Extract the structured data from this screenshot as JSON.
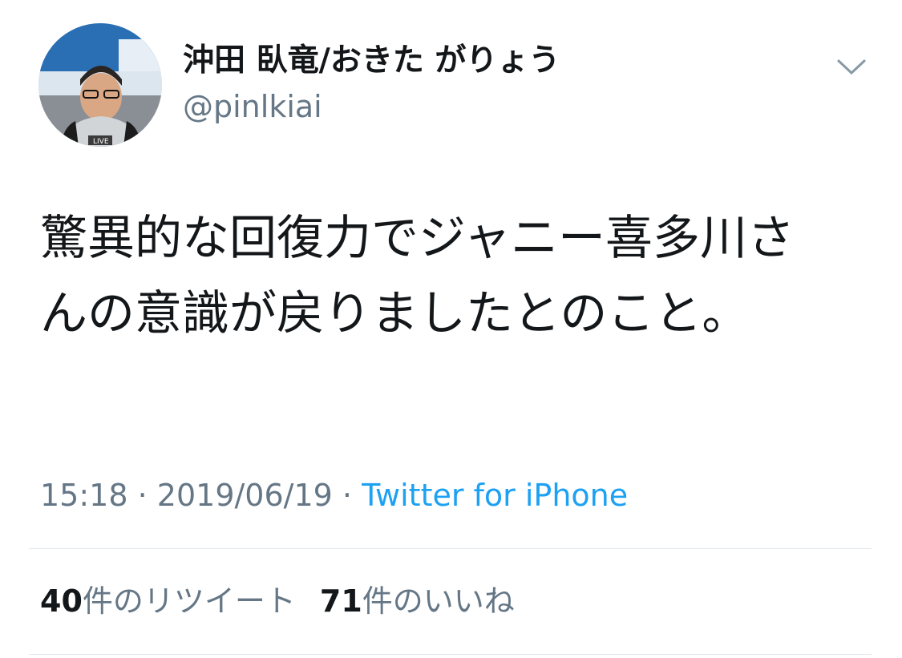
{
  "author": {
    "display_name": "沖田 臥竜/おきた がりょう",
    "handle": "@pinlkiai",
    "avatar_badge": "LIVE"
  },
  "tweet": {
    "text": "驚異的な回復力でジャニー喜多川さんの意識が戻りましたとのこと。",
    "time": "15:18",
    "separator": "·",
    "date": "2019/06/19",
    "source": "Twitter for iPhone"
  },
  "stats": {
    "retweets": {
      "count": "40",
      "label": "件のリツイート"
    },
    "likes": {
      "count": "71",
      "label": "件のいいね"
    }
  },
  "colors": {
    "text": "#14171a",
    "secondary": "#657786",
    "link": "#1da1f2",
    "divider": "#e1e8ed"
  },
  "icons": {
    "caret": "chevron-down-icon"
  }
}
